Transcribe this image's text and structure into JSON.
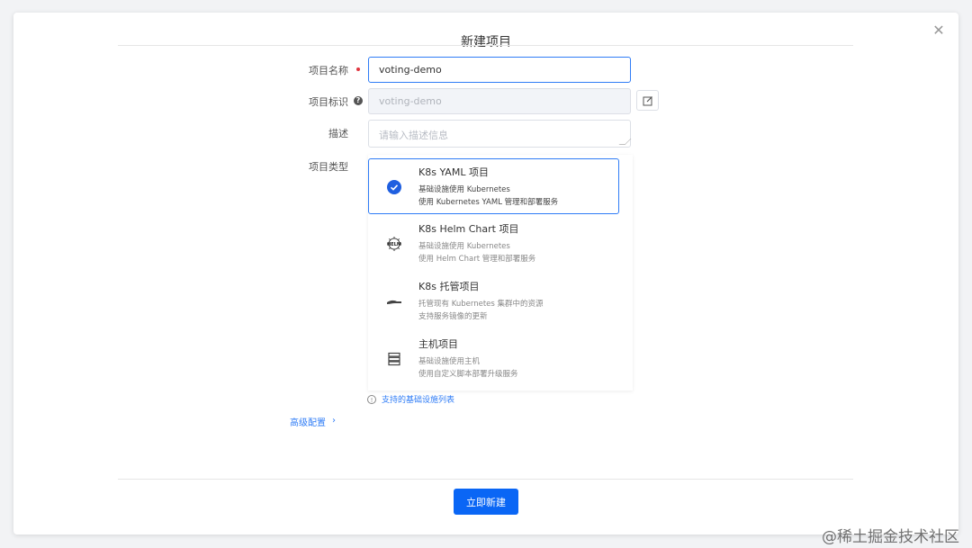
{
  "dialog": {
    "title": "新建项目",
    "close_icon": "close-icon"
  },
  "form": {
    "name": {
      "label": "项目名称",
      "value": "voting-demo",
      "required": true
    },
    "identifier": {
      "label": "项目标识",
      "value": "voting-demo",
      "help_icon": "question-icon",
      "edit_icon": "edit-icon"
    },
    "description": {
      "label": "描述",
      "placeholder": "请输入描述信息"
    },
    "project_type": {
      "label": "项目类型",
      "options": [
        {
          "title": "K8s YAML 项目",
          "desc1": "基础设施使用 Kubernetes",
          "desc2": "使用 Kubernetes YAML 管理和部署服务",
          "icon": "check-circle-icon",
          "selected": true
        },
        {
          "title": "K8s Helm Chart 项目",
          "desc1": "基础设施使用 Kubernetes",
          "desc2": "使用 Helm Chart 管理和部署服务",
          "icon": "helm-icon",
          "selected": false
        },
        {
          "title": "K8s 托管项目",
          "desc1": "托管现有 Kubernetes 集群中的资源",
          "desc2": "支持服务镜像的更新",
          "icon": "hand-icon",
          "selected": false
        },
        {
          "title": "主机项目",
          "desc1": "基础设施使用主机",
          "desc2": "使用自定义脚本部署升级服务",
          "icon": "server-icon",
          "selected": false
        }
      ]
    },
    "infra_link": "支持的基础设施列表",
    "advanced": "高级配置"
  },
  "footer": {
    "submit": "立即新建"
  },
  "watermark": "@稀土掘金技术社区",
  "colors": {
    "primary": "#0a66f5",
    "border_focus": "#2f7cf6",
    "required": "#e0353f"
  }
}
